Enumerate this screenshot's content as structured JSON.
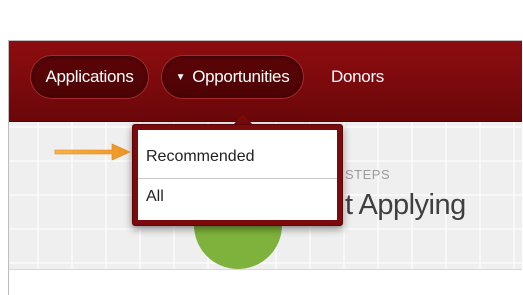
{
  "nav": {
    "applications_label": "Applications",
    "opportunities_label": "Opportunities",
    "donors_label": "Donors"
  },
  "dropdown": {
    "items": [
      "Recommended",
      "All"
    ]
  },
  "content": {
    "steps_label": "STEPS",
    "heading_fragment": "t Applying"
  },
  "colors": {
    "navbar": "#7b0a0d",
    "pill": "#4c0305",
    "step_circle": "#7fb23c",
    "annotation_arrow": "#f0a030"
  },
  "icons": [
    "caret-down-icon",
    "annotation-arrow-icon"
  ]
}
